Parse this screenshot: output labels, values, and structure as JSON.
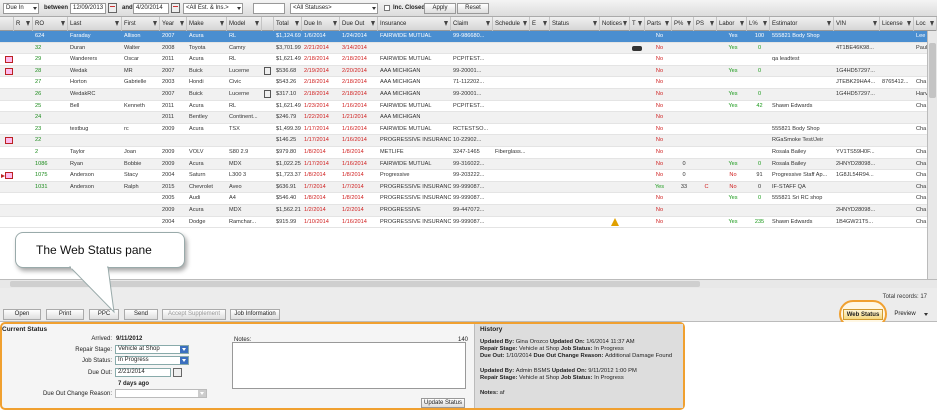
{
  "filter": {
    "date_type": "Due In",
    "between_label": "between",
    "date_from": "12/09/2013",
    "and_label": "and",
    "date_to": "4/20/2014",
    "estimator": "<All Est. & Ins.>",
    "status": "<All Statuses>",
    "inc_closed_label": "Inc. Closed",
    "apply_label": "Apply",
    "reset_label": "Reset"
  },
  "columns": [
    "",
    "R",
    "RO",
    "Last",
    "First",
    "Year",
    "Make",
    "Model",
    "",
    "Total",
    "Due In",
    "Due Out",
    "Insurance",
    "Claim",
    "Schedule",
    "E",
    "Status",
    "Notices",
    "T",
    "Parts",
    "P%",
    "PS",
    "Labor",
    "L%",
    "Estimator",
    "VIN",
    "License",
    "Loc"
  ],
  "rows": [
    {
      "ro": "624",
      "last": "Faraday",
      "first": "Allison",
      "year": "2007",
      "make": "Acura",
      "model": "RL",
      "total": "$1,124.69",
      "due_in": "1/6/2014",
      "due_out": "1/24/2014",
      "ins": "FAIRWIDE MUTUAL",
      "claim": "99-986680...",
      "parts": "No",
      "labor": "Yes",
      "lp": "100",
      "est": "555821 Body Shop",
      "vin": "",
      "lic": "",
      "loc": "Lee",
      "sel": true
    },
    {
      "ro": "32",
      "last": "Duran",
      "first": "Walter",
      "year": "2008",
      "make": "Toyota",
      "model": "Camry",
      "total": "$3,701.99",
      "due_in": "2/21/2014",
      "due_out": "3/14/2014",
      "ins": "",
      "claim": "",
      "parts": "No",
      "labor": "Yes",
      "lp": "0",
      "est": "",
      "vin": "4T1BE46K98...",
      "lic": "",
      "loc": "Paul",
      "car": true
    },
    {
      "ro": "29",
      "last": "Wanderers",
      "first": "Oscar",
      "year": "2011",
      "make": "Acura",
      "model": "RL",
      "total": "$1,621.49",
      "due_in": "2/18/2014",
      "due_out": "2/18/2014",
      "ins": "FAIRWIDE MUTUAL",
      "claim": "PCPITEST...",
      "parts": "No",
      "labor": "",
      "lp": "",
      "est": "qa leadtest",
      "vin": "",
      "lic": "",
      "loc": "",
      "ricon": true
    },
    {
      "ro": "28",
      "last": "Wedak",
      "first": "MR",
      "year": "2007",
      "make": "Buick",
      "model": "Lucerne",
      "total": "$536.68",
      "due_in": "2/19/2014",
      "due_out": "2/20/2014",
      "ins": "AAA MICHIGAN",
      "claim": "99-20001...",
      "parts": "No",
      "labor": "Yes",
      "lp": "0",
      "est": "",
      "vin": "1G4HD57297...",
      "lic": "",
      "loc": "",
      "ricon": true,
      "ticon": true
    },
    {
      "ro": "27",
      "last": "Horton",
      "first": "Gabrielle",
      "year": "2003",
      "make": "Hondi",
      "model": "Civic",
      "total": "$543.26",
      "due_in": "2/18/2014",
      "due_out": "2/18/2014",
      "ins": "AAA MICHIGAN",
      "claim": "71-112202...",
      "parts": "No",
      "labor": "",
      "lp": "",
      "est": "",
      "vin": "JTEBK29HA4...",
      "lic": "8765412...",
      "loc": "Cha"
    },
    {
      "ro": "26",
      "last": "WedakRC",
      "first": "",
      "year": "2007",
      "make": "Buick",
      "model": "Lucerne",
      "total": "$317.10",
      "due_in": "2/18/2014",
      "due_out": "2/18/2014",
      "ins": "AAA MICHIGAN",
      "claim": "99-20001...",
      "parts": "No",
      "labor": "Yes",
      "lp": "0",
      "est": "",
      "vin": "1G4HD57297...",
      "lic": "",
      "loc": "Harv",
      "ticon": true
    },
    {
      "ro": "25",
      "last": "Bell",
      "first": "Kenneth",
      "year": "2011",
      "make": "Acura",
      "model": "RL",
      "total": "$1,621.49",
      "due_in": "1/23/2014",
      "due_out": "1/16/2014",
      "ins": "FAIRWIDE MUTUAL",
      "claim": "PCPITEST...",
      "parts": "No",
      "labor": "Yes",
      "lp": "42",
      "est": "Shawn Edwards",
      "vin": "",
      "lic": "",
      "loc": "Cha"
    },
    {
      "ro": "24",
      "last": "",
      "first": "",
      "year": "2011",
      "make": "Bentley",
      "model": "Continent...",
      "total": "$246.79",
      "due_in": "1/22/2014",
      "due_out": "1/21/2014",
      "ins": "AAA MICHIGAN",
      "claim": "",
      "parts": "No",
      "labor": "",
      "lp": "",
      "est": "",
      "vin": "",
      "lic": "",
      "loc": ""
    },
    {
      "ro": "23",
      "last": "testbug",
      "first": "rc",
      "year": "2009",
      "make": "Acura",
      "model": "TSX",
      "total": "$1,499.39",
      "due_in": "1/17/2014",
      "due_out": "1/16/2014",
      "ins": "FAIRWIDE MUTUAL",
      "claim": "RCTESTSO...",
      "parts": "No",
      "labor": "",
      "lp": "",
      "est": "555821 Body Shop",
      "vin": "",
      "lic": "",
      "loc": "Cha"
    },
    {
      "ro": "22",
      "last": "",
      "first": "",
      "year": "",
      "make": "",
      "model": "",
      "total": "$146.25",
      "due_in": "1/17/2014",
      "due_out": "1/16/2014",
      "ins": "PROGRESSIVE INSURANCE",
      "claim": "10-22902...",
      "parts": "No",
      "labor": "",
      "lp": "",
      "est": "RGaSmoke Test/Jeir",
      "vin": "",
      "lic": "",
      "loc": "",
      "ricon": true
    },
    {
      "ro": "2",
      "last": "Taylor",
      "first": "Joan",
      "year": "2009",
      "make": "VOLV",
      "model": "S80 2.9",
      "total": "$979.80",
      "due_in": "1/8/2014",
      "due_out": "1/8/2014",
      "ins": "METLIFE",
      "claim": "3247-1465",
      "sched": "Fiberglass...",
      "parts": "No",
      "labor": "",
      "lp": "",
      "est": "Rosala Bailey",
      "vin": "YV1TS59H0F...",
      "lic": "",
      "loc": "Cha"
    },
    {
      "ro": "1086",
      "last": "Ryan",
      "first": "Bobbie",
      "year": "2009",
      "make": "Acura",
      "model": "MDX",
      "total": "$1,022.25",
      "due_in": "1/17/2014",
      "due_out": "1/16/2014",
      "ins": "FAIRWIDE MUTUAL",
      "claim": "99-316022...",
      "parts": "No",
      "pp": "0",
      "labor": "Yes",
      "lp": "0",
      "est": "Rosala Bailey",
      "vin": "2HNYD28098...",
      "lic": "",
      "loc": "Cha"
    },
    {
      "ro": "1075",
      "last": "Anderson",
      "first": "Stacy",
      "year": "2004",
      "make": "Saturn",
      "model": "L300 3",
      "total": "$1,723.37",
      "due_in": "1/8/2014",
      "due_out": "1/8/2014",
      "ins": "Progressive",
      "claim": "99-203222...",
      "parts": "No",
      "pp": "0",
      "labor": "No",
      "lp": "91",
      "est": "Progressive Staff Ap...",
      "vin": "1G8JL54R94...",
      "lic": "",
      "loc": "Cha",
      "ricon": true,
      "arrow": true
    },
    {
      "ro": "1031",
      "last": "Anderson",
      "first": "Ralph",
      "year": "2015",
      "make": "Chevrolet",
      "model": "Aveo",
      "total": "$636.91",
      "due_in": "1/7/2014",
      "due_out": "1/7/2014",
      "ins": "PROGRESSIVE INSURANCE",
      "claim": "99-999087...",
      "parts": "Yes",
      "pp": "33",
      "ps": "C",
      "labor": "No",
      "lp": "0",
      "est": "IF-STAFF QA",
      "vin": "",
      "lic": "",
      "loc": "Cha"
    },
    {
      "ro": "",
      "last": "",
      "first": "",
      "year": "2005",
      "make": "Audi",
      "model": "A4",
      "total": "$546.40",
      "due_in": "1/8/2014",
      "due_out": "1/8/2014",
      "ins": "PROGRESSIVE INSURANCE",
      "claim": "99-999087...",
      "parts": "No",
      "labor": "Yes",
      "lp": "0",
      "est": "555821 Sri RC shop",
      "vin": "",
      "lic": "",
      "loc": "Cha"
    },
    {
      "ro": "",
      "last": "",
      "first": "",
      "year": "2009",
      "make": "Acura",
      "model": "MDX",
      "total": "$1,562.21",
      "due_in": "1/2/2014",
      "due_out": "1/2/2014",
      "ins": "PROGRESSIVE",
      "claim": "99-447072...",
      "parts": "No",
      "labor": "",
      "lp": "",
      "est": "",
      "vin": "2HNYD28098...",
      "lic": "",
      "loc": "Cha"
    },
    {
      "ro": "",
      "last": "",
      "first": "",
      "year": "2004",
      "make": "Dodge",
      "model": "Ramchar...",
      "total": "$915.99",
      "due_in": "1/10/2014",
      "due_out": "1/16/2014",
      "ins": "PROGRESSIVE INSURANCE",
      "claim": "99-999087...",
      "warn": true,
      "parts": "No",
      "labor": "Yes",
      "lp": "235",
      "est": "Shawn Edwards",
      "vin": "1B4GW21T5...",
      "lic": "",
      "loc": "Cha"
    }
  ],
  "toolbar": {
    "open": "Open",
    "print": "Print",
    "ppc": "PPC",
    "send": "Send",
    "accept": "Accept Supplement",
    "job_info": "Job Information",
    "total_records": "Total records: 17",
    "web_status": "Web Status",
    "preview": "Preview"
  },
  "current_status": {
    "title": "Current Status",
    "arrived_label": "Arrived:",
    "arrived": "9/11/2012",
    "repair_stage_label": "Repair Stage:",
    "repair_stage": "Vehicle at Shop",
    "job_status_label": "Job Status:",
    "job_status": "In Progress",
    "due_out_label": "Due Out:",
    "due_out": "2/21/2014",
    "days_ago": "7 days ago",
    "reason_label": "Due Out Change Reason:",
    "reason": "",
    "notes_label": "Notes:",
    "notes_count": "140",
    "update_label": "Update Status"
  },
  "history": {
    "title": "History",
    "lines": [
      {
        "t": "Updated By: ",
        "v": "Gina Orozco",
        "t2": "   Updated On: ",
        "v2": "1/6/2014 11:37 AM"
      },
      {
        "t": "Repair Stage: ",
        "v": "Vehicle at Shop",
        "t2": "   Job Status: ",
        "v2": "In Progress"
      },
      {
        "t": "Due Out: ",
        "v": "1/10/2014",
        "t2": "   Due Out Change Reason: ",
        "v2": "Additional Damage Found"
      },
      {
        "t": "Updated By: ",
        "v": "Admin BSMS",
        "t2": "   Updated On: ",
        "v2": "9/11/2012 1:00 PM"
      },
      {
        "t": "Repair Stage: ",
        "v": "Vehicle at Shop",
        "t2": "   Job Status: ",
        "v2": "In Progress"
      },
      {
        "t": "Notes: ",
        "v": "af",
        "t2": "",
        "v2": ""
      }
    ]
  },
  "callout": {
    "text": "The Web Status pane"
  },
  "colors": {
    "accent": "#f0a030",
    "selected_row": "#4a8ed0",
    "red": "#d02020",
    "green": "#1a9a1a"
  }
}
